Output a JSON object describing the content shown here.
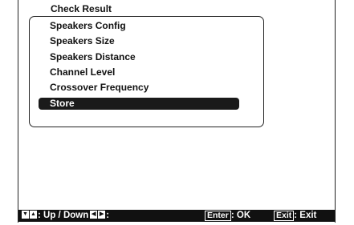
{
  "header": {
    "item": "Check Result"
  },
  "menu": {
    "items": [
      {
        "label": "Speakers Config"
      },
      {
        "label": "Speakers Size"
      },
      {
        "label": "Speakers Distance"
      },
      {
        "label": "Channel Level"
      },
      {
        "label": "Crossover Frequency"
      },
      {
        "label": "Store"
      }
    ],
    "selected": "Store"
  },
  "status_bar": {
    "updown_label": ": Up / Down",
    "leftright_label": ":",
    "enter_key": "Enter",
    "enter_label": ": OK",
    "exit_key": "Exit",
    "exit_label": ": Exit"
  },
  "icons": {
    "down": "arrow-down-icon",
    "up": "arrow-up-icon",
    "left": "arrow-left-icon",
    "right": "arrow-right-icon"
  }
}
